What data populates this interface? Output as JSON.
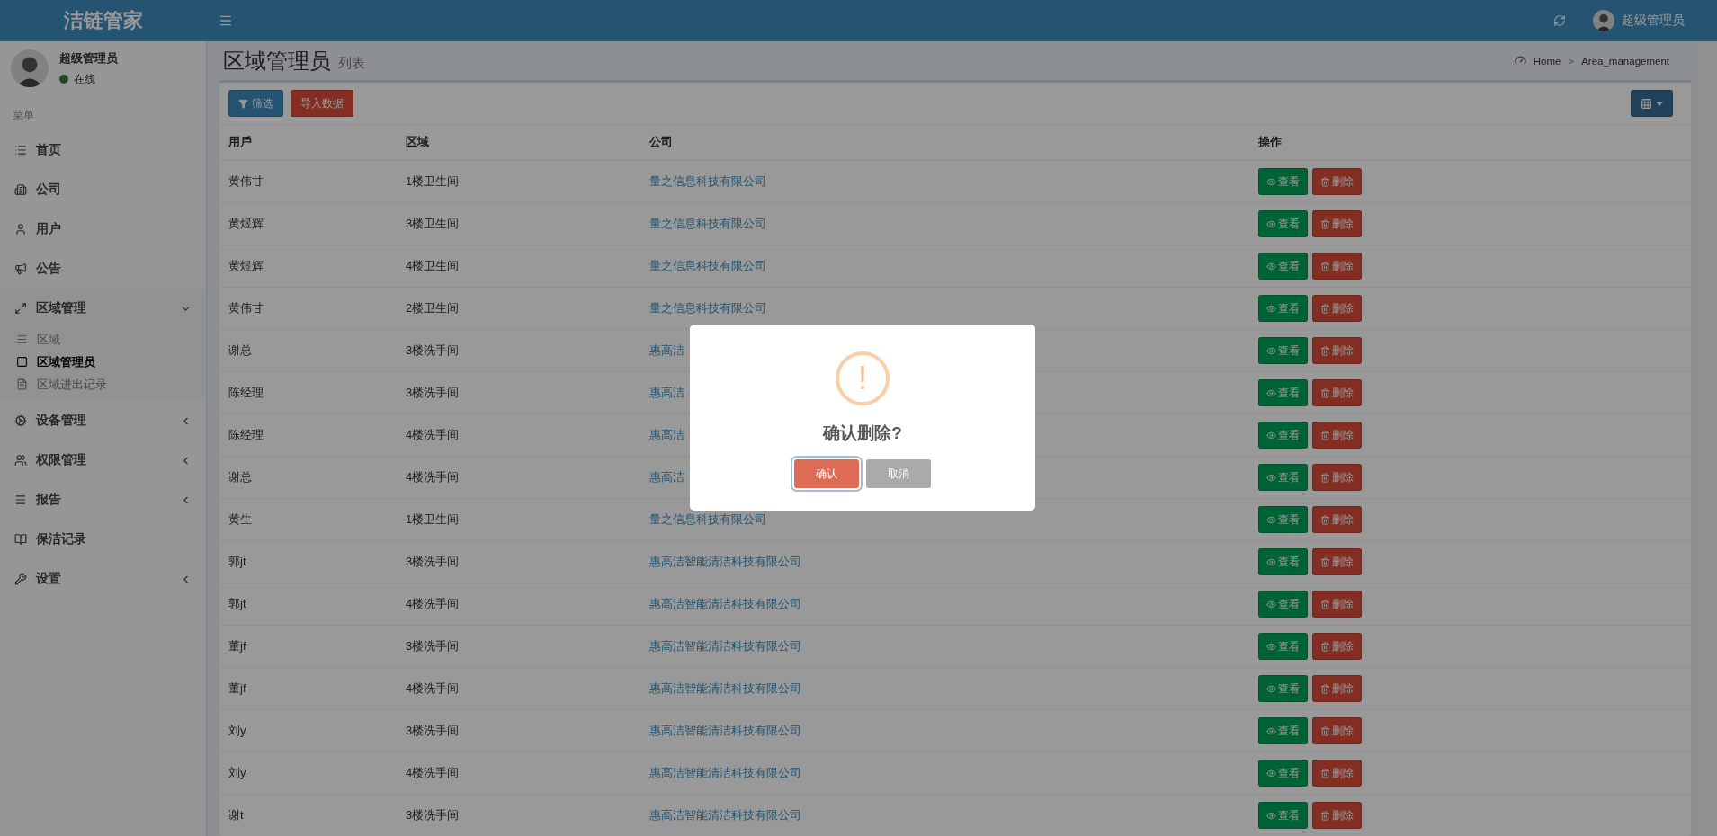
{
  "header": {
    "logo": "洁链管家",
    "user_name": "超级管理员"
  },
  "sidebar": {
    "user": {
      "name": "超级管理员",
      "status": "在线"
    },
    "menu_header": "菜单",
    "items": [
      {
        "label": "首页",
        "kind": "link"
      },
      {
        "label": "公司",
        "kind": "link"
      },
      {
        "label": "用户",
        "kind": "link"
      },
      {
        "label": "公告",
        "kind": "link"
      },
      {
        "label": "区域管理",
        "kind": "group",
        "expanded": true,
        "children": [
          {
            "label": "区域",
            "selected": false
          },
          {
            "label": "区域管理员",
            "selected": true
          },
          {
            "label": "区域进出记录",
            "selected": false
          }
        ]
      },
      {
        "label": "设备管理",
        "kind": "group",
        "expanded": false
      },
      {
        "label": "权限管理",
        "kind": "group",
        "expanded": false
      },
      {
        "label": "报告",
        "kind": "group",
        "expanded": false
      },
      {
        "label": "保洁记录",
        "kind": "link"
      },
      {
        "label": "设置",
        "kind": "group",
        "expanded": false
      }
    ]
  },
  "page": {
    "title": "区域管理员",
    "subtitle": "列表",
    "breadcrumb": [
      "Home",
      "Area_management"
    ],
    "breadcrumb_separator": ">"
  },
  "toolbar": {
    "filter_button": "筛选",
    "import_button": "导入数据"
  },
  "table": {
    "columns": [
      "用戶",
      "区域",
      "公司",
      "操作"
    ],
    "rows": [
      {
        "user": "黄伟甘",
        "area": "1楼卫生间",
        "company": "量之信息科技有限公司",
        "actions": [
          "查看",
          "删除"
        ]
      },
      {
        "user": "黄煜辉",
        "area": "3楼卫生间",
        "company": "量之信息科技有限公司",
        "actions": [
          "查看",
          "删除"
        ]
      },
      {
        "user": "黄煜辉",
        "area": "4楼卫生间",
        "company": "量之信息科技有限公司",
        "actions": [
          "查看",
          "删除"
        ]
      },
      {
        "user": "黄伟甘",
        "area": "2楼卫生间",
        "company": "量之信息科技有限公司",
        "actions": [
          "查看",
          "删除"
        ]
      },
      {
        "user": "谢总",
        "area": "3楼洗手间",
        "company": "惠高洁",
        "actions": [
          "查看",
          "删除"
        ]
      },
      {
        "user": "陈经理",
        "area": "3楼洗手间",
        "company": "惠高洁",
        "actions": [
          "查看",
          "删除"
        ]
      },
      {
        "user": "陈经理",
        "area": "4楼洗手间",
        "company": "惠高洁",
        "actions": [
          "查看",
          "删除"
        ]
      },
      {
        "user": "谢总",
        "area": "4楼洗手间",
        "company": "惠高洁",
        "actions": [
          "查看",
          "删除"
        ]
      },
      {
        "user": "黄生",
        "area": "1楼卫生间",
        "company": "量之信息科技有限公司",
        "actions": [
          "查看",
          "删除"
        ]
      },
      {
        "user": "郭jt",
        "area": "3楼洗手间",
        "company": "惠高洁智能清洁科技有限公司",
        "actions": [
          "查看",
          "删除"
        ]
      },
      {
        "user": "郭jt",
        "area": "4楼洗手间",
        "company": "惠高洁智能清洁科技有限公司",
        "actions": [
          "查看",
          "删除"
        ]
      },
      {
        "user": "董jf",
        "area": "3楼洗手间",
        "company": "惠高洁智能清洁科技有限公司",
        "actions": [
          "查看",
          "删除"
        ]
      },
      {
        "user": "董jf",
        "area": "4楼洗手间",
        "company": "惠高洁智能清洁科技有限公司",
        "actions": [
          "查看",
          "删除"
        ]
      },
      {
        "user": "刘y",
        "area": "3楼洗手间",
        "company": "惠高洁智能清洁科技有限公司",
        "actions": [
          "查看",
          "删除"
        ]
      },
      {
        "user": "刘y",
        "area": "4楼洗手间",
        "company": "惠高洁智能清洁科技有限公司",
        "actions": [
          "查看",
          "删除"
        ]
      },
      {
        "user": "谢t",
        "area": "3楼洗手间",
        "company": "惠高洁智能清洁科技有限公司",
        "actions": [
          "查看",
          "删除"
        ]
      }
    ]
  },
  "dialog": {
    "icon": "!",
    "message": "确认删除?",
    "confirm_button": "确认",
    "cancel_button": "取消"
  }
}
